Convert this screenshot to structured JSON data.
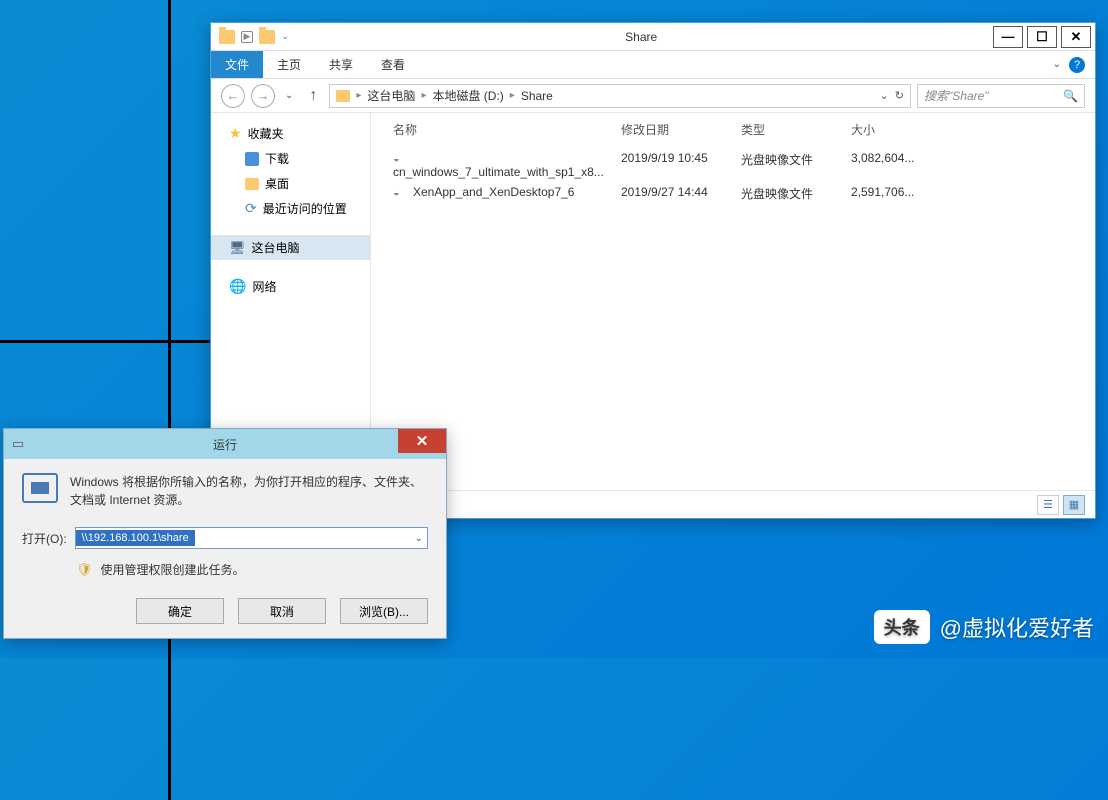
{
  "explorer": {
    "title": "Share",
    "ribbon": {
      "file": "文件",
      "home": "主页",
      "share": "共享",
      "view": "查看"
    },
    "breadcrumb": {
      "pc": "这台电脑",
      "drive": "本地磁盘 (D:)",
      "folder": "Share"
    },
    "search_placeholder": "搜索\"Share\"",
    "sidebar": {
      "favorites": "收藏夹",
      "downloads": "下载",
      "desktop": "桌面",
      "recent": "最近访问的位置",
      "this_pc": "这台电脑",
      "network": "网络"
    },
    "columns": {
      "name": "名称",
      "date": "修改日期",
      "type": "类型",
      "size": "大小"
    },
    "files": [
      {
        "name": "cn_windows_7_ultimate_with_sp1_x8...",
        "date": "2019/9/19 10:45",
        "type": "光盘映像文件",
        "size": "3,082,604..."
      },
      {
        "name": "XenApp_and_XenDesktop7_6",
        "date": "2019/9/27 14:44",
        "type": "光盘映像文件",
        "size": "2,591,706..."
      }
    ]
  },
  "run": {
    "title": "运行",
    "description": "Windows 将根据你所输入的名称，为你打开相应的程序、文件夹、文档或 Internet 资源。",
    "open_label": "打开(O):",
    "input_value": "\\\\192.168.100.1\\share",
    "admin_note": "使用管理权限创建此任务。",
    "ok": "确定",
    "cancel": "取消",
    "browse": "浏览(B)..."
  },
  "watermark": {
    "logo": "头条",
    "text": "@虚拟化爱好者"
  }
}
